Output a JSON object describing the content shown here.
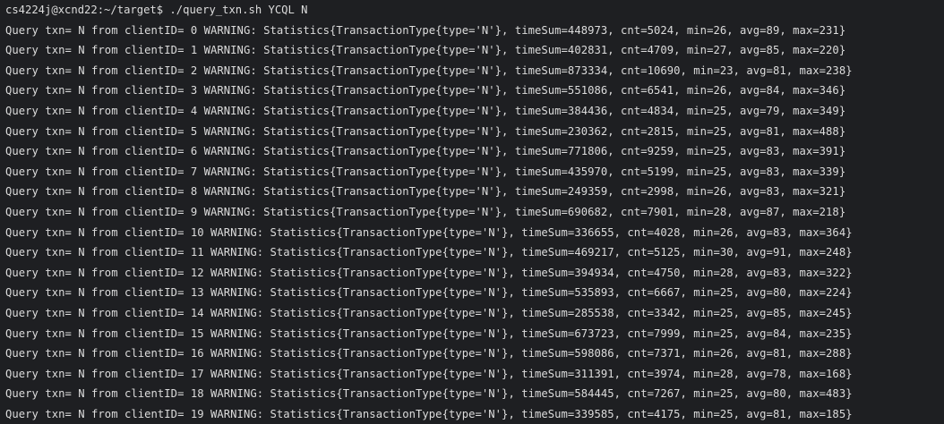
{
  "terminal": {
    "prompt": "cs4224j@xcnd22:~/target$ ./query_txn.sh YCQL N",
    "lines": [
      "Query txn= N from clientID= 0 WARNING: Statistics{TransactionType{type='N'}, timeSum=448973, cnt=5024, min=26, avg=89, max=231}",
      "Query txn= N from clientID= 1 WARNING: Statistics{TransactionType{type='N'}, timeSum=402831, cnt=4709, min=27, avg=85, max=220}",
      "Query txn= N from clientID= 2 WARNING: Statistics{TransactionType{type='N'}, timeSum=873334, cnt=10690, min=23, avg=81, max=238}",
      "Query txn= N from clientID= 3 WARNING: Statistics{TransactionType{type='N'}, timeSum=551086, cnt=6541, min=26, avg=84, max=346}",
      "Query txn= N from clientID= 4 WARNING: Statistics{TransactionType{type='N'}, timeSum=384436, cnt=4834, min=25, avg=79, max=349}",
      "Query txn= N from clientID= 5 WARNING: Statistics{TransactionType{type='N'}, timeSum=230362, cnt=2815, min=25, avg=81, max=488}",
      "Query txn= N from clientID= 6 WARNING: Statistics{TransactionType{type='N'}, timeSum=771806, cnt=9259, min=25, avg=83, max=391}",
      "Query txn= N from clientID= 7 WARNING: Statistics{TransactionType{type='N'}, timeSum=435970, cnt=5199, min=25, avg=83, max=339}",
      "Query txn= N from clientID= 8 WARNING: Statistics{TransactionType{type='N'}, timeSum=249359, cnt=2998, min=26, avg=83, max=321}",
      "Query txn= N from clientID= 9 WARNING: Statistics{TransactionType{type='N'}, timeSum=690682, cnt=7901, min=28, avg=87, max=218}",
      "Query txn= N from clientID= 10 WARNING: Statistics{TransactionType{type='N'}, timeSum=336655, cnt=4028, min=26, avg=83, max=364}",
      "Query txn= N from clientID= 11 WARNING: Statistics{TransactionType{type='N'}, timeSum=469217, cnt=5125, min=30, avg=91, max=248}",
      "Query txn= N from clientID= 12 WARNING: Statistics{TransactionType{type='N'}, timeSum=394934, cnt=4750, min=28, avg=83, max=322}",
      "Query txn= N from clientID= 13 WARNING: Statistics{TransactionType{type='N'}, timeSum=535893, cnt=6667, min=25, avg=80, max=224}",
      "Query txn= N from clientID= 14 WARNING: Statistics{TransactionType{type='N'}, timeSum=285538, cnt=3342, min=25, avg=85, max=245}",
      "Query txn= N from clientID= 15 WARNING: Statistics{TransactionType{type='N'}, timeSum=673723, cnt=7999, min=25, avg=84, max=235}",
      "Query txn= N from clientID= 16 WARNING: Statistics{TransactionType{type='N'}, timeSum=598086, cnt=7371, min=26, avg=81, max=288}",
      "Query txn= N from clientID= 17 WARNING: Statistics{TransactionType{type='N'}, timeSum=311391, cnt=3974, min=28, avg=78, max=168}",
      "Query txn= N from clientID= 18 WARNING: Statistics{TransactionType{type='N'}, timeSum=584445, cnt=7267, min=25, avg=80, max=483}",
      "Query txn= N from clientID= 19 WARNING: Statistics{TransactionType{type='N'}, timeSum=339585, cnt=4175, min=25, avg=81, max=185}"
    ]
  },
  "colors": {
    "background": "#1e1f22",
    "text": "#dcdcdc"
  }
}
